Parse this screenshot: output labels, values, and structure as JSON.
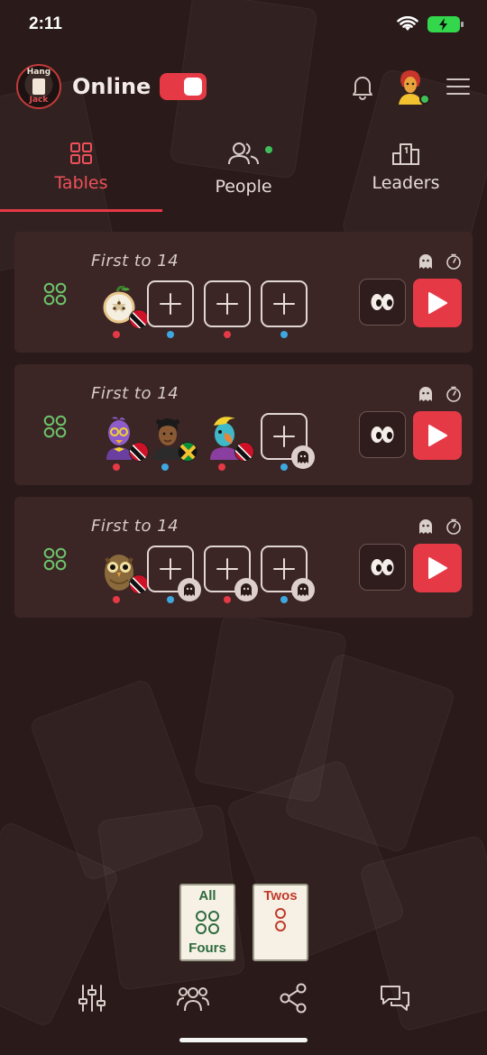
{
  "status_bar": {
    "time": "2:11"
  },
  "header": {
    "logo_text_top": "Hang",
    "logo_text_bottom": "Jack",
    "status_label": "Online",
    "online_toggle": "on"
  },
  "tabs": [
    {
      "label": "Tables",
      "active": true,
      "icon": "grid-icon"
    },
    {
      "label": "People",
      "active": false,
      "icon": "people-icon",
      "has_notification": true
    },
    {
      "label": "Leaders",
      "active": false,
      "icon": "podium-icon"
    }
  ],
  "tables": [
    {
      "title": "First to 14",
      "mode_icon": "four-dots-icon",
      "seats": [
        {
          "type": "player",
          "avatar": "apple-slice-avatar",
          "flag": "trinidad-flag",
          "team_color": "#e63946"
        },
        {
          "type": "empty",
          "team_color": "#3fa7e0"
        },
        {
          "type": "empty",
          "team_color": "#e63946"
        },
        {
          "type": "empty",
          "team_color": "#3fa7e0"
        }
      ]
    },
    {
      "title": "First to 14",
      "mode_icon": "four-dots-icon",
      "seats": [
        {
          "type": "player",
          "avatar": "purple-bird-avatar",
          "flag": "trinidad-flag",
          "team_color": "#e63946"
        },
        {
          "type": "player",
          "avatar": "man-avatar",
          "flag": "jamaica-flag",
          "team_color": "#3fa7e0"
        },
        {
          "type": "player",
          "avatar": "parrot-avatar",
          "flag": "trinidad-flag",
          "team_color": "#e63946"
        },
        {
          "type": "empty-ghost",
          "team_color": "#3fa7e0"
        }
      ]
    },
    {
      "title": "First to 14",
      "mode_icon": "four-dots-icon",
      "seats": [
        {
          "type": "player",
          "avatar": "owl-avatar",
          "flag": "trinidad-flag",
          "team_color": "#e63946"
        },
        {
          "type": "empty-ghost",
          "team_color": "#3fa7e0"
        },
        {
          "type": "empty-ghost",
          "team_color": "#e63946"
        },
        {
          "type": "empty-ghost",
          "team_color": "#3fa7e0"
        }
      ]
    }
  ],
  "filters": {
    "fours": {
      "top": "All",
      "bottom": "Fours"
    },
    "twos": {
      "top": "Twos"
    }
  },
  "colors": {
    "accent": "#e63946",
    "background": "#2a1a19",
    "card": "#3b2625",
    "team_blue": "#3fa7e0",
    "mode_green": "#6dc26a",
    "filter_green": "#2d6a3e",
    "filter_red": "#c0392b"
  },
  "bottom_nav": [
    "sliders-icon",
    "group-icon",
    "share-icon",
    "chat-icon"
  ]
}
